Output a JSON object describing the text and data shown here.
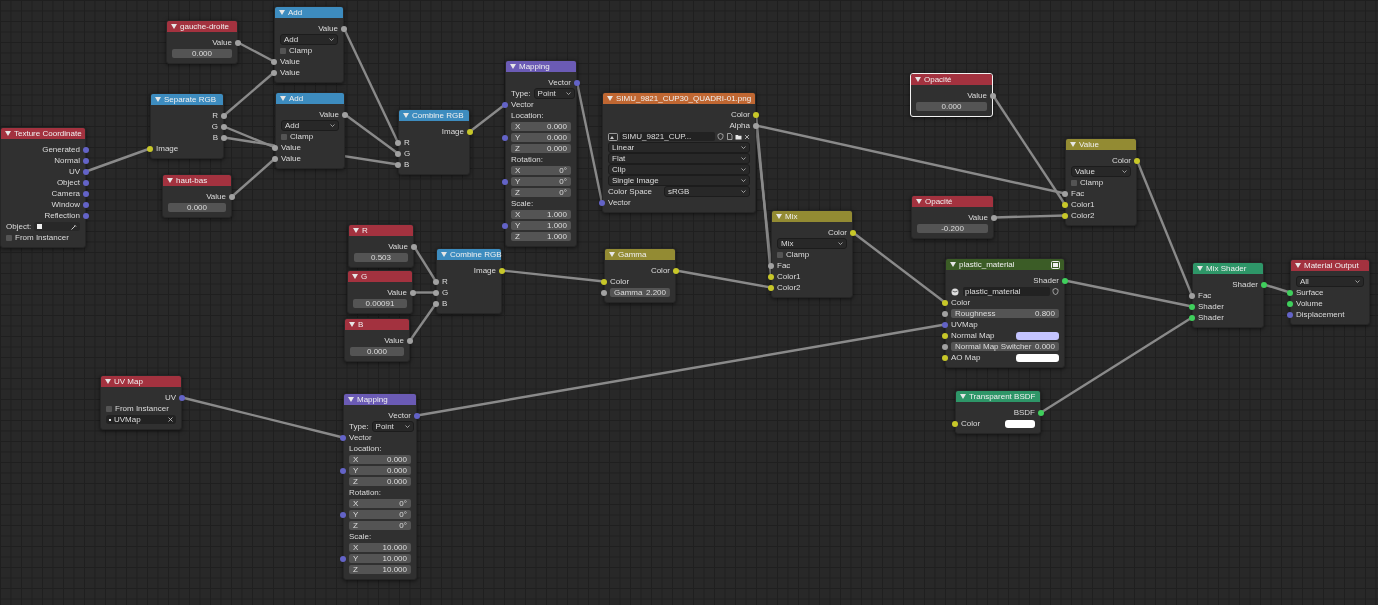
{
  "nodes": [
    {
      "title": "Texture Coordinate",
      "kind": "input",
      "selected": false,
      "rows": [
        {
          "kind": "output",
          "label": "Generated",
          "socket": {
            "color": "#6363c7"
          }
        },
        {
          "kind": "output",
          "label": "Normal",
          "socket": {
            "color": "#6363c7"
          }
        },
        {
          "kind": "output",
          "label": "UV",
          "socket": {
            "color": "#6363c7"
          }
        },
        {
          "kind": "output",
          "label": "Object",
          "socket": {
            "color": "#6363c7"
          }
        },
        {
          "kind": "output",
          "label": "Camera",
          "socket": {
            "color": "#6363c7"
          }
        },
        {
          "kind": "output",
          "label": "Window",
          "socket": {
            "color": "#6363c7"
          }
        },
        {
          "kind": "output",
          "label": "Reflection",
          "socket": {
            "color": "#6363c7"
          }
        },
        {
          "kind": "object_field",
          "label": "Object:"
        },
        {
          "kind": "checkbox",
          "label": "From Instancer",
          "checked": false
        }
      ]
    },
    {
      "title": "gauche-droite",
      "kind": "input",
      "selected": false,
      "rows": [
        {
          "kind": "output",
          "label": "Value",
          "socket": {
            "color": "#a1a1a1"
          }
        },
        {
          "kind": "field",
          "value": "0.000"
        }
      ]
    },
    {
      "title": "Add",
      "kind": "converter",
      "selected": false,
      "rows": [
        {
          "kind": "output",
          "label": "Value",
          "socket": {
            "color": "#a1a1a1"
          }
        },
        {
          "kind": "dropdown",
          "value": "Add"
        },
        {
          "kind": "checkbox",
          "label": "Clamp",
          "checked": false
        },
        {
          "kind": "input",
          "label": "Value",
          "socket": {
            "color": "#a1a1a1"
          }
        },
        {
          "kind": "input",
          "label": "Value",
          "socket": {
            "color": "#a1a1a1"
          }
        }
      ]
    },
    {
      "title": "Separate RGB",
      "kind": "converter",
      "selected": false,
      "rows": [
        {
          "kind": "output",
          "label": "R",
          "socket": {
            "color": "#a1a1a1"
          }
        },
        {
          "kind": "output",
          "label": "G",
          "socket": {
            "color": "#a1a1a1"
          }
        },
        {
          "kind": "output",
          "label": "B",
          "socket": {
            "color": "#a1a1a1"
          }
        },
        {
          "kind": "input",
          "label": "Image",
          "socket": {
            "color": "#c7c729"
          }
        }
      ]
    },
    {
      "title": "Add",
      "kind": "converter",
      "selected": false,
      "rows": [
        {
          "kind": "output",
          "label": "Value",
          "socket": {
            "color": "#a1a1a1"
          }
        },
        {
          "kind": "dropdown",
          "value": "Add"
        },
        {
          "kind": "checkbox",
          "label": "Clamp",
          "checked": false
        },
        {
          "kind": "input",
          "label": "Value",
          "socket": {
            "color": "#a1a1a1"
          }
        },
        {
          "kind": "input",
          "label": "Value",
          "socket": {
            "color": "#a1a1a1"
          }
        }
      ]
    },
    {
      "title": "haut-bas",
      "kind": "input",
      "selected": false,
      "rows": [
        {
          "kind": "output",
          "label": "Value",
          "socket": {
            "color": "#a1a1a1"
          }
        },
        {
          "kind": "field",
          "value": "0.000"
        }
      ]
    },
    {
      "title": "Combine RGB",
      "kind": "converter",
      "selected": false,
      "rows": [
        {
          "kind": "output",
          "label": "Image",
          "socket": {
            "color": "#c7c729"
          }
        },
        {
          "kind": "input",
          "label": "R",
          "socket": {
            "color": "#a1a1a1"
          }
        },
        {
          "kind": "input",
          "label": "G",
          "socket": {
            "color": "#a1a1a1"
          }
        },
        {
          "kind": "input",
          "label": "B",
          "socket": {
            "color": "#a1a1a1"
          }
        }
      ]
    },
    {
      "title": "Mapping",
      "kind": "vector",
      "selected": false,
      "rows": [
        {
          "kind": "output",
          "label": "Vector",
          "socket": {
            "color": "#6363c7"
          }
        },
        {
          "kind": "labeled_dropdown",
          "label": "Type:",
          "value": "Point"
        },
        {
          "kind": "input",
          "label": "Vector",
          "socket": {
            "color": "#6363c7"
          }
        },
        {
          "kind": "heading",
          "label": "Location:"
        },
        {
          "kind": "labeled_field",
          "label": "X",
          "value": "0.000"
        },
        {
          "kind": "labeled_field",
          "label": "Y",
          "value": "0.000",
          "socket": {
            "color": "#6363c7"
          }
        },
        {
          "kind": "labeled_field",
          "label": "Z",
          "value": "0.000"
        },
        {
          "kind": "heading",
          "label": "Rotation:"
        },
        {
          "kind": "labeled_field",
          "label": "X",
          "value": "0°"
        },
        {
          "kind": "labeled_field",
          "label": "Y",
          "value": "0°",
          "socket": {
            "color": "#6363c7"
          }
        },
        {
          "kind": "labeled_field",
          "label": "Z",
          "value": "0°"
        },
        {
          "kind": "heading",
          "label": "Scale:"
        },
        {
          "kind": "labeled_field",
          "label": "X",
          "value": "1.000"
        },
        {
          "kind": "labeled_field",
          "label": "Y",
          "value": "1.000",
          "socket": {
            "color": "#6363c7"
          }
        },
        {
          "kind": "labeled_field",
          "label": "Z",
          "value": "1.000"
        }
      ]
    },
    {
      "title": "SIMU_9821_CUP30_QUADRI-01.png",
      "kind": "texture",
      "selected": false,
      "rows": [
        {
          "kind": "output",
          "label": "Color",
          "socket": {
            "color": "#c7c729"
          }
        },
        {
          "kind": "output",
          "label": "Alpha",
          "socket": {
            "color": "#a1a1a1"
          }
        },
        {
          "kind": "image_selector",
          "value": "SIMU_9821_CUP..."
        },
        {
          "kind": "dropdown",
          "value": "Linear"
        },
        {
          "kind": "dropdown",
          "value": "Flat"
        },
        {
          "kind": "dropdown",
          "value": "Clip"
        },
        {
          "kind": "dropdown",
          "value": "Single Image"
        },
        {
          "kind": "labeled_dropdown",
          "label": "Color Space",
          "value": "sRGB"
        },
        {
          "kind": "input",
          "label": "Vector",
          "socket": {
            "color": "#6363c7"
          }
        }
      ]
    },
    {
      "title": "Opacité",
      "kind": "input",
      "selected": true,
      "rows": [
        {
          "kind": "output",
          "label": "Value",
          "socket": {
            "color": "#a1a1a1"
          }
        },
        {
          "kind": "field",
          "value": "0.000"
        }
      ]
    },
    {
      "title": "Value",
      "kind": "color",
      "selected": false,
      "rows": [
        {
          "kind": "output",
          "label": "Color",
          "socket": {
            "color": "#c7c729"
          }
        },
        {
          "kind": "dropdown",
          "value": "Value"
        },
        {
          "kind": "checkbox",
          "label": "Clamp",
          "checked": false
        },
        {
          "kind": "input",
          "label": "Fac",
          "socket": {
            "color": "#a1a1a1"
          }
        },
        {
          "kind": "input",
          "label": "Color1",
          "socket": {
            "color": "#c7c729"
          }
        },
        {
          "kind": "input",
          "label": "Color2",
          "socket": {
            "color": "#c7c729"
          }
        }
      ]
    },
    {
      "title": "Opacité",
      "kind": "input",
      "selected": false,
      "rows": [
        {
          "kind": "output",
          "label": "Value",
          "socket": {
            "color": "#a1a1a1"
          }
        },
        {
          "kind": "field",
          "value": "-0.200"
        }
      ]
    },
    {
      "title": "Mix",
      "kind": "color",
      "selected": false,
      "rows": [
        {
          "kind": "output",
          "label": "Color",
          "socket": {
            "color": "#c7c729"
          }
        },
        {
          "kind": "dropdown",
          "value": "Mix"
        },
        {
          "kind": "checkbox",
          "label": "Clamp",
          "checked": false
        },
        {
          "kind": "input",
          "label": "Fac",
          "socket": {
            "color": "#a1a1a1"
          }
        },
        {
          "kind": "input",
          "label": "Color1",
          "socket": {
            "color": "#c7c729"
          }
        },
        {
          "kind": "input",
          "label": "Color2",
          "socket": {
            "color": "#c7c729"
          }
        }
      ]
    },
    {
      "title": "R",
      "kind": "input",
      "selected": false,
      "rows": [
        {
          "kind": "output",
          "label": "Value",
          "socket": {
            "color": "#a1a1a1"
          }
        },
        {
          "kind": "field",
          "value": "0.503"
        }
      ]
    },
    {
      "title": "G",
      "kind": "input",
      "selected": false,
      "rows": [
        {
          "kind": "output",
          "label": "Value",
          "socket": {
            "color": "#a1a1a1"
          }
        },
        {
          "kind": "field",
          "value": "0.00091"
        }
      ]
    },
    {
      "title": "B",
      "kind": "input",
      "selected": false,
      "rows": [
        {
          "kind": "output",
          "label": "Value",
          "socket": {
            "color": "#a1a1a1"
          }
        },
        {
          "kind": "field",
          "value": "0.000"
        }
      ]
    },
    {
      "title": "Combine RGB",
      "kind": "converter",
      "selected": false,
      "rows": [
        {
          "kind": "output",
          "label": "Image",
          "socket": {
            "color": "#c7c729"
          }
        },
        {
          "kind": "input",
          "label": "R",
          "socket": {
            "color": "#a1a1a1"
          }
        },
        {
          "kind": "input",
          "label": "G",
          "socket": {
            "color": "#a1a1a1"
          }
        },
        {
          "kind": "input",
          "label": "B",
          "socket": {
            "color": "#a1a1a1"
          }
        }
      ]
    },
    {
      "title": "Gamma",
      "kind": "color",
      "selected": false,
      "rows": [
        {
          "kind": "output",
          "label": "Color",
          "socket": {
            "color": "#c7c729"
          }
        },
        {
          "kind": "input",
          "label": "Color",
          "socket": {
            "color": "#c7c729"
          }
        },
        {
          "kind": "labeled_field",
          "label": "Gamma",
          "value": "2.200",
          "socket": {
            "color": "#a1a1a1"
          }
        }
      ]
    },
    {
      "title": "plastic_material",
      "kind": "group",
      "selected": false,
      "rows": [
        {
          "kind": "output",
          "label": "Shader",
          "socket": {
            "color": "#3fcf5c"
          }
        },
        {
          "kind": "material_selector",
          "value": "plastic_material"
        },
        {
          "kind": "input",
          "label": "Color",
          "socket": {
            "color": "#c7c729"
          }
        },
        {
          "kind": "labeled_field",
          "label": "Roughness",
          "value": "0.800",
          "socket": {
            "color": "#a1a1a1"
          }
        },
        {
          "kind": "input",
          "label": "UVMap",
          "socket": {
            "color": "#6363c7"
          }
        },
        {
          "kind": "color_input",
          "label": "Normal Map",
          "socket": {
            "color": "#c7c729"
          },
          "color": "#c4c4ff"
        },
        {
          "kind": "labeled_field",
          "label": "Normal Map Switcher",
          "value": "0.000",
          "socket": {
            "color": "#a1a1a1"
          }
        },
        {
          "kind": "color_input",
          "label": "AO Map",
          "socket": {
            "color": "#c7c729"
          },
          "color": "#ffffff"
        }
      ]
    },
    {
      "title": "Transparent BSDF",
      "kind": "shader",
      "selected": false,
      "rows": [
        {
          "kind": "output",
          "label": "BSDF",
          "socket": {
            "color": "#3fcf5c"
          }
        },
        {
          "kind": "color_input",
          "label": "Color",
          "socket": {
            "color": "#c7c729"
          },
          "color": "#ffffff"
        }
      ]
    },
    {
      "title": "Mix Shader",
      "kind": "shader",
      "selected": false,
      "rows": [
        {
          "kind": "output",
          "label": "Shader",
          "socket": {
            "color": "#3fcf5c"
          }
        },
        {
          "kind": "input",
          "label": "Fac",
          "socket": {
            "color": "#a1a1a1"
          }
        },
        {
          "kind": "input",
          "label": "Shader",
          "socket": {
            "color": "#3fcf5c"
          }
        },
        {
          "kind": "input",
          "label": "Shader",
          "socket": {
            "color": "#3fcf5c"
          }
        }
      ]
    },
    {
      "title": "Material Output",
      "kind": "output",
      "selected": false,
      "rows": [
        {
          "kind": "dropdown",
          "value": "All"
        },
        {
          "kind": "input",
          "label": "Surface",
          "socket": {
            "color": "#3fcf5c"
          }
        },
        {
          "kind": "input",
          "label": "Volume",
          "socket": {
            "color": "#3fcf5c"
          }
        },
        {
          "kind": "input",
          "label": "Displacement",
          "socket": {
            "color": "#6363c7"
          }
        }
      ]
    },
    {
      "title": "UV Map",
      "kind": "input",
      "selected": false,
      "rows": [
        {
          "kind": "output",
          "label": "UV",
          "socket": {
            "color": "#6363c7"
          }
        },
        {
          "kind": "checkbox",
          "label": "From Instancer",
          "checked": false
        },
        {
          "kind": "uvmap_field",
          "value": "UVMap"
        }
      ]
    },
    {
      "title": "Mapping",
      "kind": "vector",
      "selected": false,
      "rows": [
        {
          "kind": "output",
          "label": "Vector",
          "socket": {
            "color": "#6363c7"
          }
        },
        {
          "kind": "labeled_dropdown",
          "label": "Type:",
          "value": "Point"
        },
        {
          "kind": "input",
          "label": "Vector",
          "socket": {
            "color": "#6363c7"
          }
        },
        {
          "kind": "heading",
          "label": "Location:"
        },
        {
          "kind": "labeled_field",
          "label": "X",
          "value": "0.000"
        },
        {
          "kind": "labeled_field",
          "label": "Y",
          "value": "0.000",
          "socket": {
            "color": "#6363c7"
          }
        },
        {
          "kind": "labeled_field",
          "label": "Z",
          "value": "0.000"
        },
        {
          "kind": "heading",
          "label": "Rotation:"
        },
        {
          "kind": "labeled_field",
          "label": "X",
          "value": "0°"
        },
        {
          "kind": "labeled_field",
          "label": "Y",
          "value": "0°",
          "socket": {
            "color": "#6363c7"
          }
        },
        {
          "kind": "labeled_field",
          "label": "Z",
          "value": "0°"
        },
        {
          "kind": "heading",
          "label": "Scale:"
        },
        {
          "kind": "labeled_field",
          "label": "X",
          "value": "10.000"
        },
        {
          "kind": "labeled_field",
          "label": "Y",
          "value": "10.000",
          "socket": {
            "color": "#6363c7"
          }
        },
        {
          "kind": "labeled_field",
          "label": "Z",
          "value": "10.000"
        }
      ]
    }
  ]
}
